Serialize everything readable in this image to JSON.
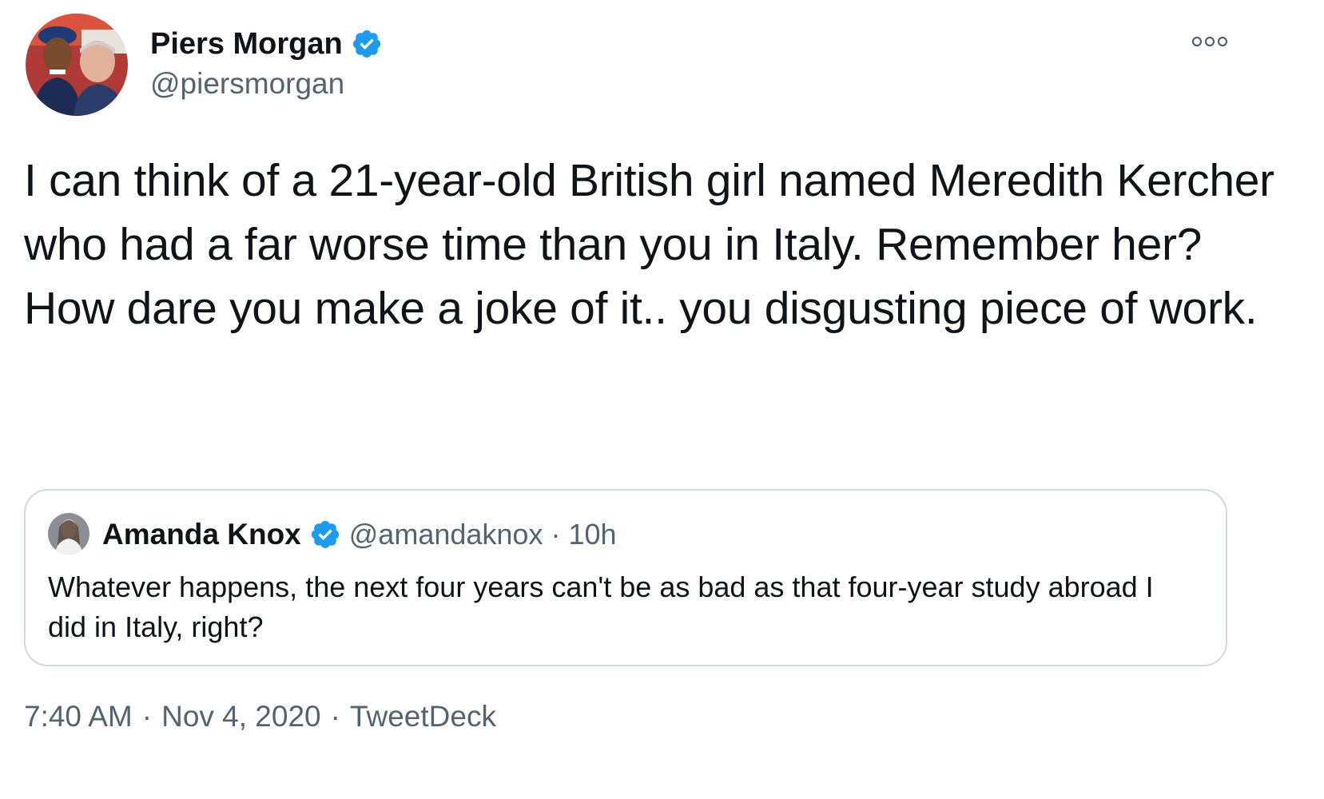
{
  "tweet": {
    "author": {
      "name": "Piers Morgan",
      "handle": "@piersmorgan"
    },
    "icons": {
      "avatar": "author-avatar",
      "verified": "verified-badge-icon",
      "more": "more-options-icon"
    },
    "text": "I can think of a 21-year-old British girl named Meredith Kercher who had a far worse time than you in Italy. Remember her?\nHow dare you make a joke of it.. you disgusting piece of work.",
    "quoted": {
      "name": "Amanda Knox",
      "handle": "@amandaknox",
      "separator": "·",
      "time": "10h",
      "text": "Whatever happens, the next four years can't be as bad as that four-year study abroad I did in Italy, right?"
    },
    "meta": {
      "time": "7:40 AM",
      "separator": "·",
      "date": "Nov 4, 2020",
      "source": "TweetDeck"
    }
  },
  "colors": {
    "verified_blue": "#1d9bf0",
    "secondary_text": "#536471",
    "border": "#cfd9de"
  }
}
